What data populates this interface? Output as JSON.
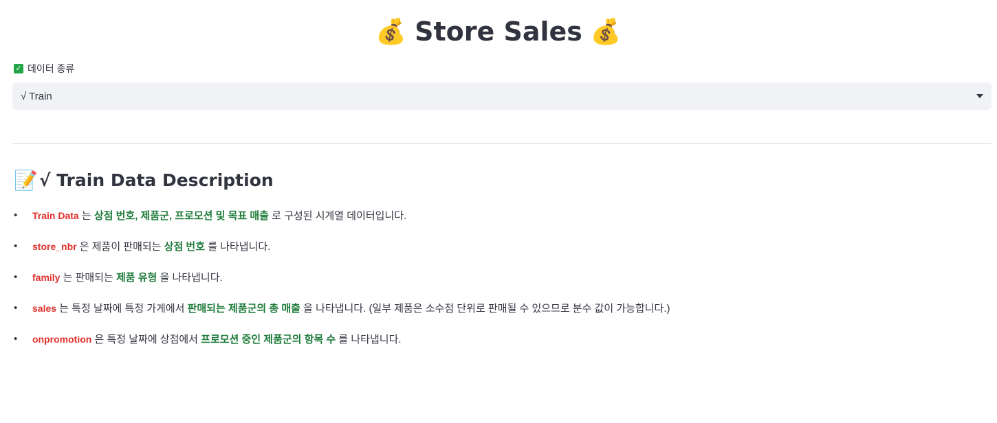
{
  "header": {
    "title": "Store Sales",
    "emoji_left": "💰",
    "emoji_right": "💰"
  },
  "data_type": {
    "checkbox_label": "데이터 종류",
    "selected_value": "√ Train"
  },
  "description": {
    "emoji": "📝",
    "title": "√ Train Data Description",
    "items": [
      {
        "key": "Train Data",
        "text1": " 는 ",
        "highlight": "상점 번호, 제품군, 프로모션 및 목표 매출",
        "text2": " 로 구성된 시계열 데이터입니다."
      },
      {
        "key": "store_nbr",
        "text1": " 은 제품이 판매되는 ",
        "highlight": "상점 번호",
        "text2": " 를 나타냅니다."
      },
      {
        "key": "family",
        "text1": " 는 판매되는 ",
        "highlight": "제품 유형",
        "text2": " 을 나타냅니다."
      },
      {
        "key": "sales",
        "text1": " 는 특정 날짜에 특정 가게에서 ",
        "highlight": "판매되는 제품군의 총 매출",
        "text2": " 을 나타냅니다. (일부 제품은 소수점 단위로 판매될 수 있으므로 분수 값이 가능합니다.)"
      },
      {
        "key": "onpromotion",
        "text1": " 은 특정 날짜에 상점에서 ",
        "highlight": "프로모션 중인 제품군의 항목 수",
        "text2": " 를 나타냅니다."
      }
    ]
  },
  "colors": {
    "key_red": "#e0302b",
    "highlight_green": "#1e7b3a",
    "select_bg": "#f0f2f6"
  }
}
